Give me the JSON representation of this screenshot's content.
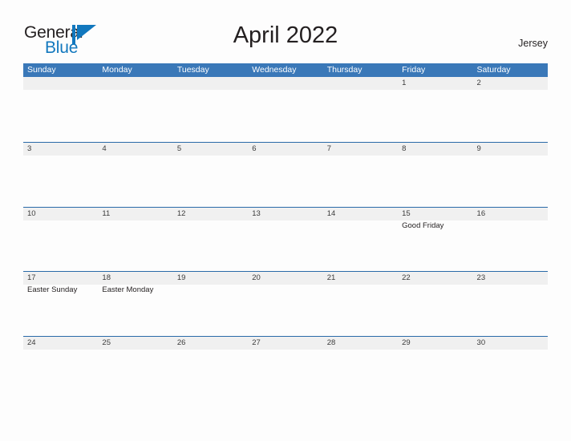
{
  "brand": {
    "name_part1": "General",
    "name_part2": "Blue",
    "flag_icon": "flag-icon",
    "flag_color": "#1278be",
    "text_color": "#231f20"
  },
  "header": {
    "title": "April 2022",
    "region": "Jersey"
  },
  "theme": {
    "header_blue": "#3a78b8",
    "rule_blue": "#2a6aa8",
    "number_band_gray": "#f0f0f0",
    "page_background": "#fdfdfd"
  },
  "calendar": {
    "weekdays": [
      "Sunday",
      "Monday",
      "Tuesday",
      "Wednesday",
      "Thursday",
      "Friday",
      "Saturday"
    ],
    "weeks": [
      [
        {
          "day": "",
          "events": []
        },
        {
          "day": "",
          "events": []
        },
        {
          "day": "",
          "events": []
        },
        {
          "day": "",
          "events": []
        },
        {
          "day": "",
          "events": []
        },
        {
          "day": "1",
          "events": []
        },
        {
          "day": "2",
          "events": []
        }
      ],
      [
        {
          "day": "3",
          "events": []
        },
        {
          "day": "4",
          "events": []
        },
        {
          "day": "5",
          "events": []
        },
        {
          "day": "6",
          "events": []
        },
        {
          "day": "7",
          "events": []
        },
        {
          "day": "8",
          "events": []
        },
        {
          "day": "9",
          "events": []
        }
      ],
      [
        {
          "day": "10",
          "events": []
        },
        {
          "day": "11",
          "events": []
        },
        {
          "day": "12",
          "events": []
        },
        {
          "day": "13",
          "events": []
        },
        {
          "day": "14",
          "events": []
        },
        {
          "day": "15",
          "events": [
            "Good Friday"
          ]
        },
        {
          "day": "16",
          "events": []
        }
      ],
      [
        {
          "day": "17",
          "events": [
            "Easter Sunday"
          ]
        },
        {
          "day": "18",
          "events": [
            "Easter Monday"
          ]
        },
        {
          "day": "19",
          "events": []
        },
        {
          "day": "20",
          "events": []
        },
        {
          "day": "21",
          "events": []
        },
        {
          "day": "22",
          "events": []
        },
        {
          "day": "23",
          "events": []
        }
      ],
      [
        {
          "day": "24",
          "events": []
        },
        {
          "day": "25",
          "events": []
        },
        {
          "day": "26",
          "events": []
        },
        {
          "day": "27",
          "events": []
        },
        {
          "day": "28",
          "events": []
        },
        {
          "day": "29",
          "events": []
        },
        {
          "day": "30",
          "events": []
        }
      ]
    ]
  }
}
